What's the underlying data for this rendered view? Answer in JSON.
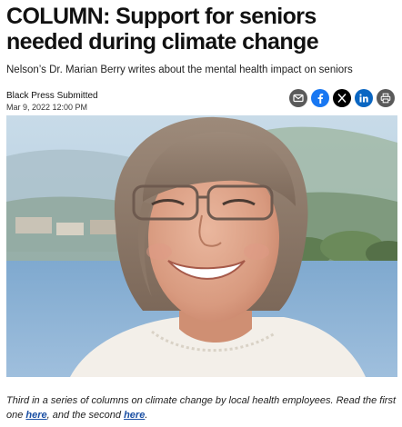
{
  "article": {
    "headline": "COLUMN: Support for seniors needed during climate change",
    "subhead": "Nelson’s Dr. Marian Berry writes about the mental health impact on seniors",
    "author": "Black Press Submitted",
    "date": "Mar 9, 2022 12:00 PM"
  },
  "share": {
    "buttons": [
      {
        "name": "email-icon",
        "color": "#555555"
      },
      {
        "name": "facebook-icon",
        "color": "#1877f2"
      },
      {
        "name": "x-icon",
        "color": "#000000"
      },
      {
        "name": "linkedin-icon",
        "color": "#0a66c2"
      },
      {
        "name": "print-icon",
        "color": "#555555"
      }
    ]
  },
  "photo": {
    "alt_subject": "woman-portrait"
  },
  "caption": {
    "text_1": "Third in a series of columns on climate change by local health employees. Read the first one ",
    "link_1": "here",
    "text_2": ", and the second ",
    "link_2": "here",
    "text_3": "."
  }
}
